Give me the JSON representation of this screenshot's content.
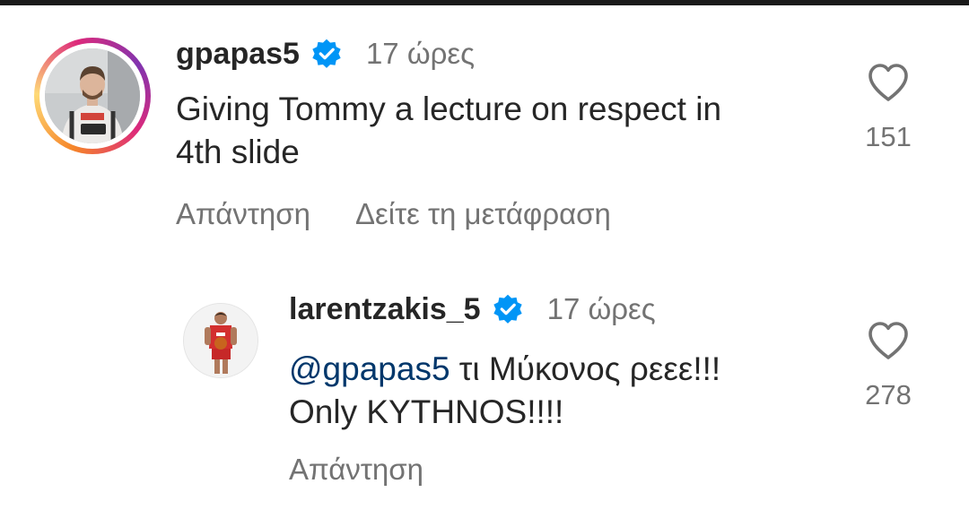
{
  "comments": [
    {
      "username": "gpapas5",
      "verified": true,
      "time": "17 ώρες",
      "text_line1": "Giving Tommy a lecture on respect in",
      "text_line2": "4th slide",
      "actions": {
        "reply": "Απάντηση",
        "translate": "Δείτε τη μετάφραση"
      },
      "likes": "151",
      "has_story_ring": true
    },
    {
      "username": "larentzakis_5",
      "verified": true,
      "time": "17 ώρες",
      "mention": "@gpapas5",
      "text_line1_rest": " τι Μύκονος ρεεε!!!",
      "text_line2": "Only KYTHNOS!!!!",
      "actions": {
        "reply": "Απάντηση"
      },
      "likes": "278"
    }
  ],
  "colors": {
    "verified_badge": "#0095f6",
    "mention": "#00376b",
    "secondary_text": "#737373"
  },
  "icons": [
    "verified-badge-icon",
    "heart-outline-icon"
  ]
}
